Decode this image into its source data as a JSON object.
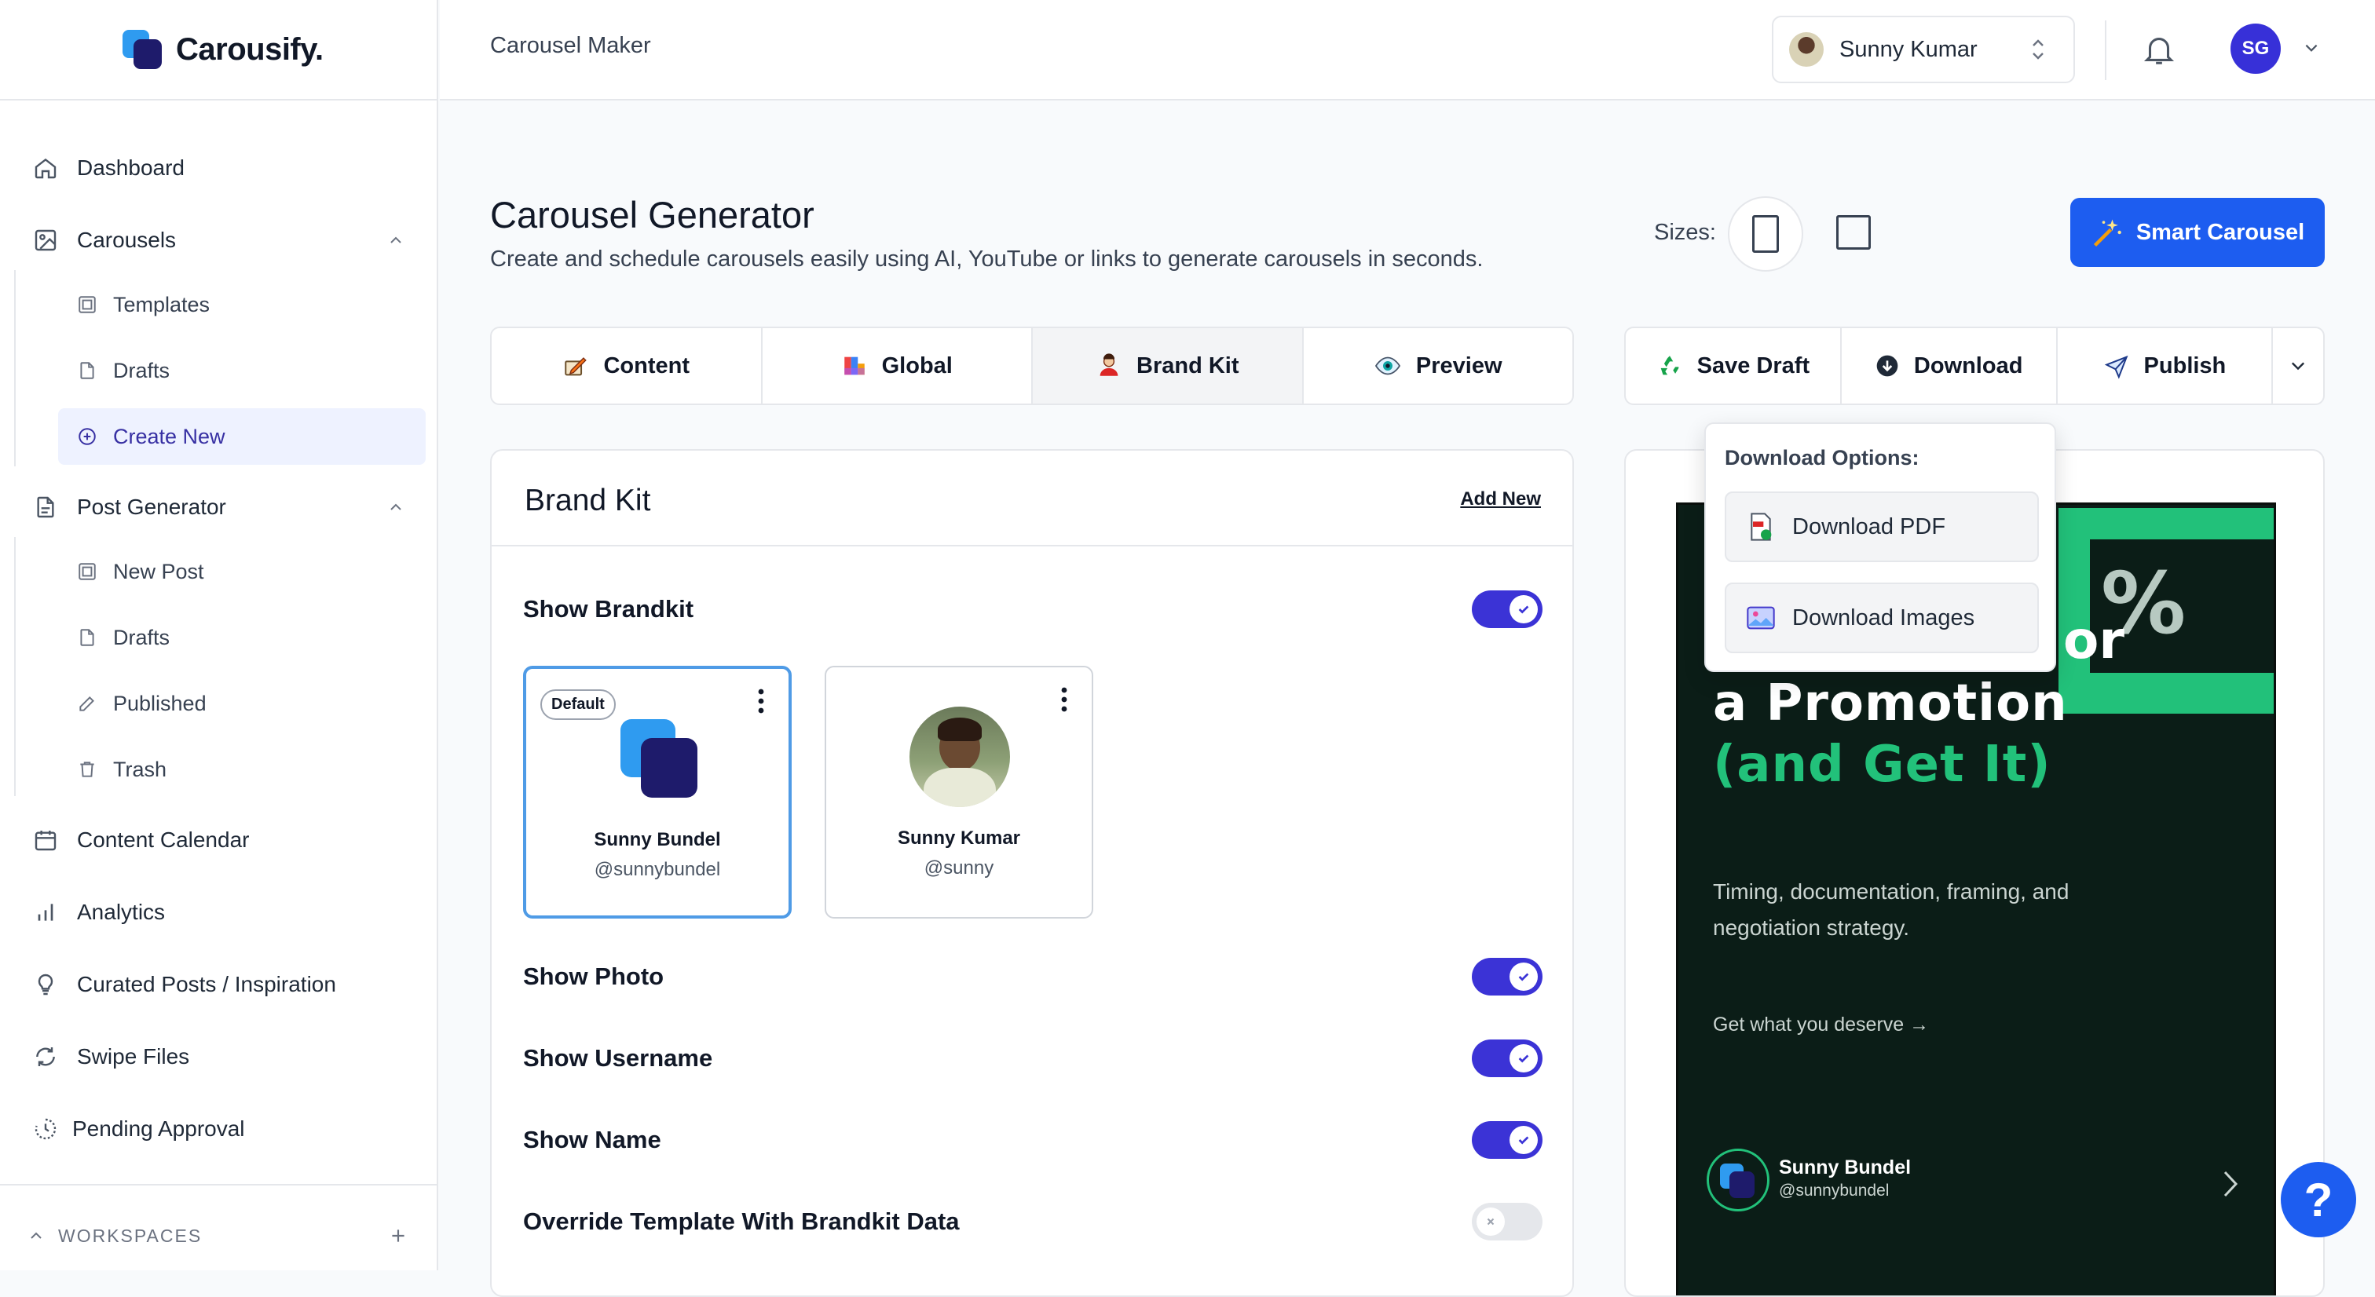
{
  "app": {
    "name": "Carousify."
  },
  "topbar": {
    "title": "Carousel Maker",
    "account_name": "Sunny Kumar",
    "user_initials": "SG"
  },
  "sidebar": {
    "items": [
      {
        "label": "Dashboard",
        "icon": "home-icon"
      },
      {
        "label": "Carousels",
        "icon": "image-icon"
      },
      {
        "label": "Post Generator",
        "icon": "document-icon"
      },
      {
        "label": "Content Calendar",
        "icon": "calendar-icon"
      },
      {
        "label": "Analytics",
        "icon": "bar-chart-icon"
      },
      {
        "label": "Curated Posts / Inspiration",
        "icon": "lightbulb-icon"
      },
      {
        "label": "Swipe Files",
        "icon": "refresh-icon"
      },
      {
        "label": "Pending Approval",
        "icon": "clock-icon"
      }
    ],
    "carousel_sub": [
      {
        "label": "Templates"
      },
      {
        "label": "Drafts"
      },
      {
        "label": "Create New",
        "active": true
      }
    ],
    "post_sub": [
      {
        "label": "New Post"
      },
      {
        "label": "Drafts"
      },
      {
        "label": "Published"
      },
      {
        "label": "Trash"
      }
    ],
    "workspaces_label": "WORKSPACES"
  },
  "page": {
    "title": "Carousel Generator",
    "subtitle": "Create and schedule carousels easily using AI, YouTube or links to generate carousels in seconds.",
    "sizes_label": "Sizes:",
    "smart_button": "Smart Carousel"
  },
  "tabs": [
    {
      "label": "Content",
      "icon": "pencil-icon"
    },
    {
      "label": "Global",
      "icon": "palette-icon"
    },
    {
      "label": "Brand Kit",
      "icon": "person-icon",
      "active": true
    },
    {
      "label": "Preview",
      "icon": "eye-icon"
    }
  ],
  "actions": {
    "save_draft": "Save Draft",
    "download": "Download",
    "publish": "Publish"
  },
  "download_menu": {
    "title": "Download Options:",
    "pdf": "Download PDF",
    "images": "Download Images"
  },
  "brand_kit": {
    "title": "Brand Kit",
    "add_new": "Add New",
    "show_brandkit": "Show Brandkit",
    "show_brandkit_on": true,
    "cards": [
      {
        "badge": "Default",
        "name": "Sunny Bundel",
        "username": "@sunnybundel",
        "selected": true
      },
      {
        "name": "Sunny Kumar",
        "username": "@sunny",
        "selected": false
      }
    ],
    "toggles": [
      {
        "label": "Show Photo",
        "on": true
      },
      {
        "label": "Show Username",
        "on": true
      },
      {
        "label": "Show Name",
        "on": true
      },
      {
        "label": "Override Template With Brandkit Data",
        "on": false
      }
    ]
  },
  "slide": {
    "pct": "%",
    "or_fragment": "or",
    "headline_line1": "a Promotion",
    "headline_line2": "(and Get It)",
    "body": "Timing, documentation, framing, and negotiation strategy.",
    "cta": "Get what you deserve →",
    "author_name": "Sunny Bundel",
    "author_username": "@sunnybundel"
  },
  "help": {
    "label": "?"
  },
  "colors": {
    "accent": "#1d5df0",
    "toggle_on": "#3b33d6",
    "slide_bg": "#0b1d17",
    "slide_green": "#22c17a",
    "active_nav_bg": "#eef2ff"
  }
}
